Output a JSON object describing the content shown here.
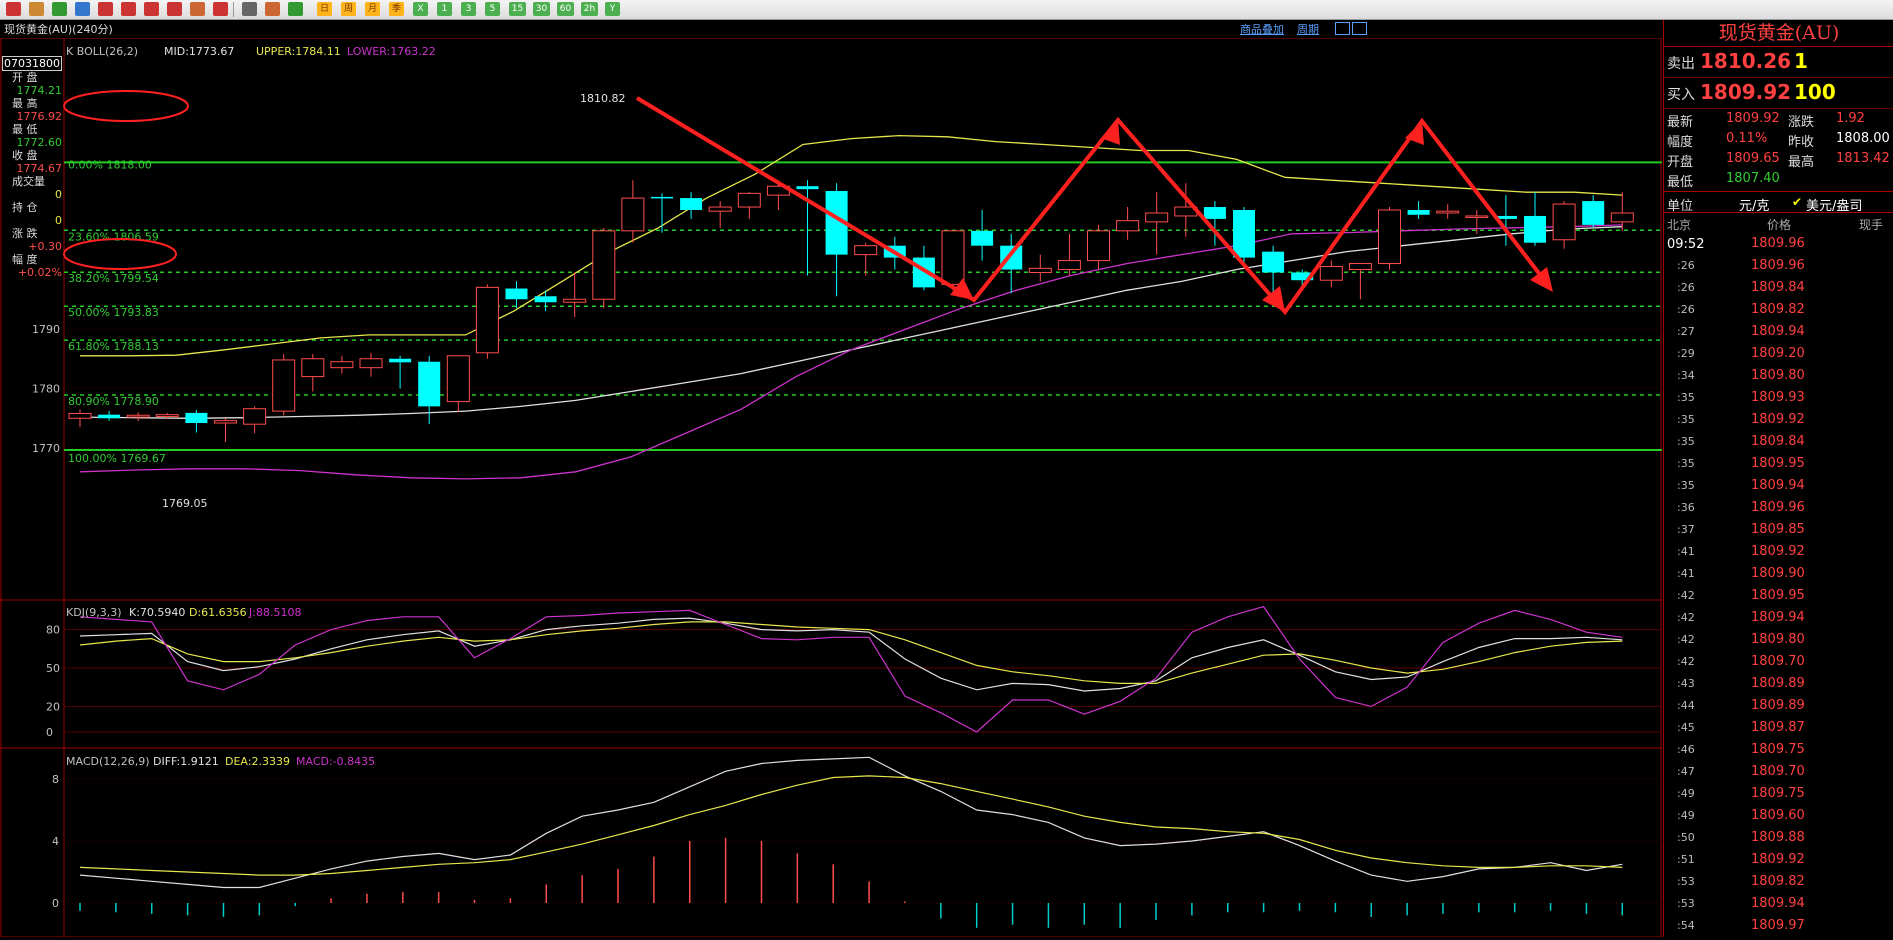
{
  "toolbar": {
    "icons": [
      "home-icon",
      "back-icon",
      "forward-icon",
      "refresh-icon",
      "zoom-in-icon",
      "zoom-out-icon",
      "window-icon",
      "pen-icon",
      "tools-icon",
      "filter-icon",
      "table-icon",
      "chart-icon",
      "indicator-icon"
    ],
    "periods": [
      "日",
      "周",
      "月",
      "季",
      "X",
      "1",
      "3",
      "5",
      "15",
      "30",
      "60",
      "2h",
      "Y"
    ]
  },
  "title": "现货黄金(AU)(240分)",
  "header_links": {
    "overlay": "商品叠加",
    "period": "周期"
  },
  "boll": {
    "name": "K  BOLL(26,2)",
    "mid": "MID:1773.67",
    "upper": "UPPER:1784.11",
    "lower": "LOWER:1763.22"
  },
  "kdj": {
    "name": "KDJ(9,3,3)",
    "k": "K:70.5940",
    "d": "D:61.6356",
    "j": "J:88.5108"
  },
  "macd": {
    "name": "MACD(12,26,9)",
    "diff": "DIFF:1.9121",
    "dea": "DEA:2.3339",
    "macd": "MACD:-0.8435"
  },
  "left_info": {
    "date": "07031800",
    "open_label": "开 盘",
    "open": "1774.21",
    "high_label": "最 高",
    "high": "1776.92",
    "low_label": "最 低",
    "low": "1772.60",
    "close_label": "收 盘",
    "close": "1774.67",
    "volume_label": "成交量",
    "volume": "0",
    "position_label": "持 仓",
    "position": "0",
    "change_label": "涨 跌",
    "change": "+0.30",
    "pct_label": "幅 度",
    "pct": "+0.02%"
  },
  "fib_levels": [
    {
      "label": "0.00% 1818.00"
    },
    {
      "label": "23.60% 1806.59"
    },
    {
      "label": "38.20% 1799.54"
    },
    {
      "label": "50.00% 1793.83"
    },
    {
      "label": "61.80% 1788.13"
    },
    {
      "label": "80.90% 1778.90"
    },
    {
      "label": "100.00% 1769.67"
    }
  ],
  "price_axis": [
    "1790",
    "1780",
    "1770"
  ],
  "kdj_axis": [
    "80",
    "50",
    "20",
    "0"
  ],
  "macd_axis": [
    "8",
    "4",
    "0"
  ],
  "annotations": {
    "high": "1810.82",
    "low": "1769.05"
  },
  "colors": {
    "up": "#ff4d4d",
    "down": "#00ffff",
    "mid": "#e0e0e0",
    "upper": "#e6e64d",
    "lower": "#cc33cc",
    "fib": "#33cc33",
    "accent": "#ff2020",
    "panel_border": "#a00000"
  },
  "right_panel": {
    "title": "现货黄金(AU)",
    "sell_label": "卖出",
    "sell_price": "1810.26",
    "sell_vol": "1",
    "buy_label": "买入",
    "buy_price": "1809.92",
    "buy_vol": "100",
    "stats": [
      {
        "l1": "最新",
        "v1": "1809.92",
        "l2": "涨跌",
        "v2": "1.92"
      },
      {
        "l1": "幅度",
        "v1": "0.11%",
        "l2": "昨收",
        "v2": "1808.00"
      },
      {
        "l1": "开盘",
        "v1": "1809.65",
        "l2": "最高",
        "v2": "1813.42"
      },
      {
        "l1": "最低",
        "v1": "1807.40",
        "l2": "",
        "v2": ""
      }
    ],
    "unit_label": "单位",
    "unit_value": "元/克",
    "unit_alt": "美元/盎司",
    "col_time": "北京",
    "col_price": "价格",
    "col_vol": "现手",
    "ticks": [
      {
        "t": "09:52",
        "p": "1809.96"
      },
      {
        "t": ":26",
        "p": "1809.96"
      },
      {
        "t": ":26",
        "p": "1809.84"
      },
      {
        "t": ":26",
        "p": "1809.82"
      },
      {
        "t": ":27",
        "p": "1809.94"
      },
      {
        "t": ":29",
        "p": "1809.20"
      },
      {
        "t": ":34",
        "p": "1809.80"
      },
      {
        "t": ":35",
        "p": "1809.93"
      },
      {
        "t": ":35",
        "p": "1809.92"
      },
      {
        "t": ":35",
        "p": "1809.84"
      },
      {
        "t": ":35",
        "p": "1809.95"
      },
      {
        "t": ":35",
        "p": "1809.94"
      },
      {
        "t": ":36",
        "p": "1809.96"
      },
      {
        "t": ":37",
        "p": "1809.85"
      },
      {
        "t": ":41",
        "p": "1809.92"
      },
      {
        "t": ":41",
        "p": "1809.90"
      },
      {
        "t": ":42",
        "p": "1809.95"
      },
      {
        "t": ":42",
        "p": "1809.94"
      },
      {
        "t": ":42",
        "p": "1809.80"
      },
      {
        "t": ":42",
        "p": "1809.70"
      },
      {
        "t": ":43",
        "p": "1809.89"
      },
      {
        "t": ":44",
        "p": "1809.89"
      },
      {
        "t": ":45",
        "p": "1809.87"
      },
      {
        "t": ":46",
        "p": "1809.75"
      },
      {
        "t": ":47",
        "p": "1809.70"
      },
      {
        "t": ":49",
        "p": "1809.75"
      },
      {
        "t": ":49",
        "p": "1809.60"
      },
      {
        "t": ":50",
        "p": "1809.88"
      },
      {
        "t": ":51",
        "p": "1809.92"
      },
      {
        "t": ":53",
        "p": "1809.82"
      },
      {
        "t": ":53",
        "p": "1809.94"
      },
      {
        "t": ":54",
        "p": "1809.97"
      }
    ]
  },
  "chart_data": [
    {
      "type": "candlestick",
      "title": "现货黄金(AU)(240分)",
      "indicator": "BOLL(26,2)",
      "candles": [
        {
          "o": 1775.0,
          "h": 1776.5,
          "l": 1773.5,
          "c": 1775.8
        },
        {
          "o": 1775.6,
          "h": 1776.2,
          "l": 1774.6,
          "c": 1775.0
        },
        {
          "o": 1775.2,
          "h": 1776.0,
          "l": 1774.5,
          "c": 1775.5
        },
        {
          "o": 1775.3,
          "h": 1775.9,
          "l": 1774.9,
          "c": 1775.6
        },
        {
          "o": 1775.9,
          "h": 1776.4,
          "l": 1772.6,
          "c": 1774.2
        },
        {
          "o": 1774.2,
          "h": 1775.0,
          "l": 1771.0,
          "c": 1774.6
        },
        {
          "o": 1774.0,
          "h": 1777.0,
          "l": 1772.5,
          "c": 1776.6
        },
        {
          "o": 1776.2,
          "h": 1785.8,
          "l": 1775.5,
          "c": 1784.8
        },
        {
          "o": 1782.0,
          "h": 1785.8,
          "l": 1779.5,
          "c": 1785.0
        },
        {
          "o": 1783.5,
          "h": 1785.5,
          "l": 1782.5,
          "c": 1784.5
        },
        {
          "o": 1783.5,
          "h": 1786.0,
          "l": 1782.0,
          "c": 1785.0
        },
        {
          "o": 1785.0,
          "h": 1785.5,
          "l": 1780.0,
          "c": 1784.4
        },
        {
          "o": 1784.5,
          "h": 1785.5,
          "l": 1774.0,
          "c": 1777.0
        },
        {
          "o": 1777.8,
          "h": 1785.0,
          "l": 1776.0,
          "c": 1785.5
        },
        {
          "o": 1786.0,
          "h": 1797.5,
          "l": 1785.0,
          "c": 1797.0
        },
        {
          "o": 1796.8,
          "h": 1798.0,
          "l": 1793.5,
          "c": 1795.0
        },
        {
          "o": 1795.5,
          "h": 1796.5,
          "l": 1793.0,
          "c": 1794.5
        },
        {
          "o": 1794.5,
          "h": 1799.5,
          "l": 1792.0,
          "c": 1795.0
        },
        {
          "o": 1795.0,
          "h": 1807.0,
          "l": 1793.5,
          "c": 1806.5
        },
        {
          "o": 1806.5,
          "h": 1815.0,
          "l": 1804.5,
          "c": 1812.0
        },
        {
          "o": 1812.2,
          "h": 1812.8,
          "l": 1806.2,
          "c": 1812.0
        },
        {
          "o": 1812.0,
          "h": 1813.0,
          "l": 1808.5,
          "c": 1810.0
        },
        {
          "o": 1809.8,
          "h": 1811.5,
          "l": 1807.0,
          "c": 1810.5
        },
        {
          "o": 1810.5,
          "h": 1813.0,
          "l": 1808.5,
          "c": 1812.8
        },
        {
          "o": 1812.5,
          "h": 1815.0,
          "l": 1810.0,
          "c": 1814.0
        },
        {
          "o": 1814.0,
          "h": 1815.0,
          "l": 1799.0,
          "c": 1813.5
        },
        {
          "o": 1813.2,
          "h": 1814.5,
          "l": 1795.5,
          "c": 1802.5
        },
        {
          "o": 1802.5,
          "h": 1804.5,
          "l": 1799.0,
          "c": 1804.0
        },
        {
          "o": 1804.0,
          "h": 1805.5,
          "l": 1800.0,
          "c": 1802.0
        },
        {
          "o": 1802.0,
          "h": 1804.0,
          "l": 1796.5,
          "c": 1797.0
        },
        {
          "o": 1797.5,
          "h": 1806.5,
          "l": 1796.5,
          "c": 1806.5
        },
        {
          "o": 1806.5,
          "h": 1810.0,
          "l": 1801.5,
          "c": 1804.0
        },
        {
          "o": 1804.0,
          "h": 1806.0,
          "l": 1796.0,
          "c": 1800.0
        },
        {
          "o": 1799.5,
          "h": 1802.5,
          "l": 1798.0,
          "c": 1800.2
        },
        {
          "o": 1800.0,
          "h": 1806.0,
          "l": 1799.0,
          "c": 1801.5
        },
        {
          "o": 1801.5,
          "h": 1807.5,
          "l": 1800.0,
          "c": 1806.5
        },
        {
          "o": 1806.5,
          "h": 1810.5,
          "l": 1805.0,
          "c": 1808.2
        },
        {
          "o": 1808.0,
          "h": 1813.0,
          "l": 1802.5,
          "c": 1809.5
        },
        {
          "o": 1809.0,
          "h": 1814.5,
          "l": 1805.5,
          "c": 1810.5
        },
        {
          "o": 1810.5,
          "h": 1811.5,
          "l": 1804.0,
          "c": 1808.5
        },
        {
          "o": 1810.0,
          "h": 1810.5,
          "l": 1801.0,
          "c": 1802.0
        },
        {
          "o": 1803.0,
          "h": 1804.0,
          "l": 1796.0,
          "c": 1799.5
        },
        {
          "o": 1799.5,
          "h": 1800.0,
          "l": 1797.0,
          "c": 1798.2
        },
        {
          "o": 1798.2,
          "h": 1801.5,
          "l": 1797.0,
          "c": 1800.5
        },
        {
          "o": 1800.0,
          "h": 1800.5,
          "l": 1795.0,
          "c": 1801.0
        },
        {
          "o": 1801.0,
          "h": 1810.5,
          "l": 1800.0,
          "c": 1810.0
        },
        {
          "o": 1810.0,
          "h": 1811.5,
          "l": 1808.5,
          "c": 1809.2
        },
        {
          "o": 1809.5,
          "h": 1811.0,
          "l": 1808.5,
          "c": 1809.8
        },
        {
          "o": 1809.0,
          "h": 1810.0,
          "l": 1806.0,
          "c": 1809.0
        },
        {
          "o": 1809.0,
          "h": 1812.5,
          "l": 1804.0,
          "c": 1808.5
        },
        {
          "o": 1809.0,
          "h": 1813.0,
          "l": 1804.0,
          "c": 1804.5
        },
        {
          "o": 1805.0,
          "h": 1811.5,
          "l": 1803.5,
          "c": 1811.0
        },
        {
          "o": 1811.5,
          "h": 1812.5,
          "l": 1807.0,
          "c": 1807.5
        },
        {
          "o": 1808.0,
          "h": 1813.0,
          "l": 1806.5,
          "c": 1809.5
        }
      ],
      "mid": [
        1775.2,
        1775.1,
        1775.0,
        1775.1,
        1775.3,
        1775.5,
        1775.8,
        1776.2,
        1777.0,
        1778.0,
        1779.5,
        1781.0,
        1782.5,
        1784.5,
        1786.5,
        1788.5,
        1790.5,
        1792.5,
        1794.5,
        1796.5,
        1798.0,
        1800.0,
        1801.5,
        1803.0,
        1804.0,
        1805.0,
        1806.0,
        1806.8,
        1807.2
      ],
      "upper": [
        1785.5,
        1785.5,
        1785.6,
        1786.5,
        1787.5,
        1788.5,
        1789.0,
        1789.0,
        1789.0,
        1793.0,
        1798.0,
        1803.0,
        1807.0,
        1812.0,
        1816.0,
        1821.0,
        1822.0,
        1822.5,
        1822.3,
        1821.5,
        1821.0,
        1820.5,
        1820.0,
        1820.0,
        1818.5,
        1815.5,
        1815.0,
        1814.5,
        1814.0,
        1813.5,
        1813.0,
        1813.0,
        1812.5
      ],
      "lower": [
        1766.0,
        1766.3,
        1766.5,
        1766.5,
        1766.2,
        1765.5,
        1765.0,
        1764.8,
        1765.0,
        1766.0,
        1768.5,
        1772.5,
        1776.5,
        1782.0,
        1786.5,
        1790.0,
        1793.5,
        1796.5,
        1799.0,
        1801.0,
        1802.5,
        1804.0,
        1806.0,
        1806.2,
        1806.5,
        1806.8,
        1807.0,
        1807.2,
        1807.5
      ],
      "fib_levels": [
        {
          "pct": 0.0,
          "price": 1818.0
        },
        {
          "pct": 23.6,
          "price": 1806.59
        },
        {
          "pct": 38.2,
          "price": 1799.54
        },
        {
          "pct": 50.0,
          "price": 1793.83
        },
        {
          "pct": 61.8,
          "price": 1788.13
        },
        {
          "pct": 80.9,
          "price": 1778.9
        },
        {
          "pct": 100.0,
          "price": 1769.67
        }
      ],
      "y_ticks": [
        1790,
        1780,
        1770
      ]
    },
    {
      "type": "line",
      "indicator": "KDJ(9,3,3)",
      "ylim": [
        -5,
        105
      ],
      "y_ticks": [
        80,
        50,
        20,
        0
      ],
      "series": [
        {
          "name": "K",
          "values": [
            75,
            76,
            77,
            55,
            48,
            51,
            57,
            65,
            72,
            76,
            79,
            67,
            72,
            80,
            83,
            85,
            88,
            89,
            85,
            80,
            79,
            80,
            78,
            57,
            42,
            33,
            38,
            37,
            32,
            34,
            40,
            58,
            66,
            72,
            60,
            47,
            41,
            43,
            55,
            66,
            73,
            73,
            74,
            72
          ]
        },
        {
          "name": "D",
          "values": [
            68,
            71,
            73,
            61,
            55,
            55,
            58,
            62,
            67,
            71,
            74,
            71,
            72,
            76,
            79,
            81,
            84,
            86,
            86,
            84,
            82,
            81,
            80,
            72,
            62,
            52,
            47,
            44,
            40,
            38,
            38,
            46,
            53,
            60,
            61,
            56,
            50,
            46,
            49,
            55,
            62,
            67,
            70,
            71
          ]
        },
        {
          "name": "J",
          "values": [
            90,
            88,
            86,
            40,
            33,
            45,
            68,
            80,
            87,
            90,
            90,
            58,
            73,
            90,
            91,
            93,
            94,
            95,
            84,
            73,
            72,
            74,
            74,
            28,
            15,
            0,
            25,
            25,
            14,
            24,
            42,
            78,
            90,
            98,
            57,
            27,
            20,
            35,
            70,
            85,
            95,
            88,
            78,
            74
          ]
        }
      ]
    },
    {
      "type": "line",
      "indicator": "MACD(12,26,9)",
      "ylim": [
        -1.8,
        10
      ],
      "y_ticks": [
        8,
        4,
        0
      ],
      "series": [
        {
          "name": "DIFF",
          "values": [
            1.8,
            1.6,
            1.4,
            1.2,
            1.0,
            1.0,
            1.6,
            2.2,
            2.7,
            3.0,
            3.2,
            2.8,
            3.1,
            4.5,
            5.6,
            6.0,
            6.5,
            7.5,
            8.5,
            9.0,
            9.2,
            9.3,
            9.4,
            8.2,
            7.2,
            6.0,
            5.7,
            5.2,
            4.2,
            3.7,
            3.8,
            4.0,
            4.3,
            4.6,
            3.7,
            2.7,
            1.8,
            1.4,
            1.7,
            2.2,
            2.3,
            2.6,
            2.1,
            2.5
          ]
        },
        {
          "name": "DEA",
          "values": [
            2.3,
            2.2,
            2.1,
            2.0,
            1.9,
            1.8,
            1.8,
            1.9,
            2.1,
            2.3,
            2.5,
            2.6,
            2.8,
            3.3,
            3.8,
            4.4,
            5.0,
            5.7,
            6.3,
            7.0,
            7.6,
            8.1,
            8.2,
            8.1,
            7.7,
            7.2,
            6.7,
            6.2,
            5.6,
            5.2,
            4.9,
            4.8,
            4.6,
            4.5,
            4.1,
            3.4,
            2.9,
            2.6,
            2.4,
            2.3,
            2.3,
            2.4,
            2.4,
            2.3
          ]
        },
        {
          "name": "MACD",
          "values": [
            -0.5,
            -0.6,
            -0.7,
            -0.8,
            -0.9,
            -0.8,
            -0.2,
            0.3,
            0.6,
            0.7,
            0.7,
            0.2,
            0.3,
            1.2,
            1.8,
            2.2,
            3.0,
            4.0,
            4.2,
            4.0,
            3.2,
            2.5,
            1.4,
            0.1,
            -1.0,
            -1.6,
            -1.4,
            -1.6,
            -1.4,
            -1.6,
            -1.1,
            -0.8,
            -0.6,
            -0.6,
            -0.5,
            -0.6,
            -0.9,
            -0.8,
            -0.7,
            -0.6,
            -0.6,
            -0.5,
            -0.7,
            -0.8
          ]
        }
      ]
    }
  ]
}
